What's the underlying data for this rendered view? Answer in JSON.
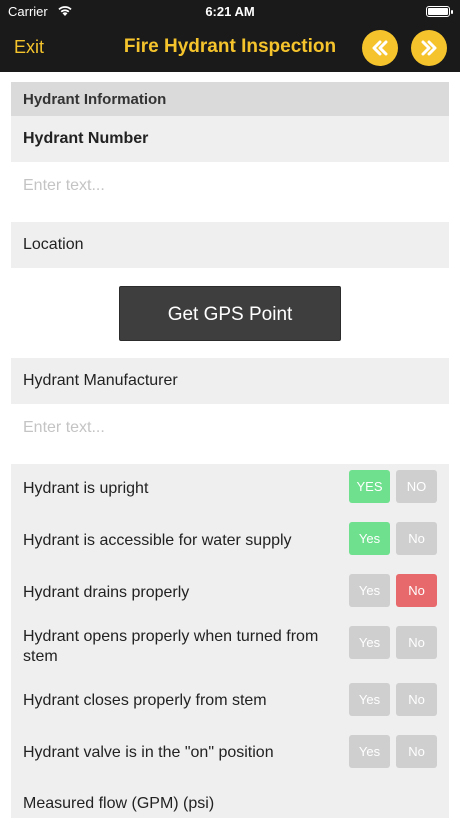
{
  "status_bar": {
    "carrier": "Carrier",
    "time": "6:21 AM"
  },
  "nav": {
    "exit_label": "Exit",
    "title": "Fire Hydrant Inspection",
    "prev_icon": "double-chevron-left-icon",
    "next_icon": "double-chevron-right-icon",
    "accent_color": "#f5c42c"
  },
  "section": {
    "title": "Hydrant Information"
  },
  "fields": {
    "hydrant_number": {
      "label": "Hydrant Number",
      "placeholder": "Enter text...",
      "value": ""
    },
    "location": {
      "label": "Location"
    },
    "gps_button": "Get GPS Point",
    "manufacturer": {
      "label": "Hydrant Manufacturer",
      "placeholder": "Enter text...",
      "value": ""
    }
  },
  "questions": [
    {
      "label": "Hydrant is upright",
      "yes": "YES",
      "no": "NO",
      "selected": "yes"
    },
    {
      "label": "Hydrant is accessible for water supply",
      "yes": "Yes",
      "no": "No",
      "selected": "yes"
    },
    {
      "label": "Hydrant drains properly",
      "yes": "Yes",
      "no": "No",
      "selected": "no"
    },
    {
      "label": "Hydrant opens properly when turned from stem",
      "yes": "Yes",
      "no": "No",
      "selected": ""
    },
    {
      "label": "Hydrant closes properly from stem",
      "yes": "Yes",
      "no": "No",
      "selected": ""
    },
    {
      "label": "Hydrant valve is in the \"on\" position",
      "yes": "Yes",
      "no": "No",
      "selected": ""
    }
  ],
  "cut_off_label": "Measured flow (GPM) (psi)",
  "colors": {
    "yes_selected": "#6fe08e",
    "no_selected": "#e8696c",
    "unselected": "#cfcfcf"
  }
}
